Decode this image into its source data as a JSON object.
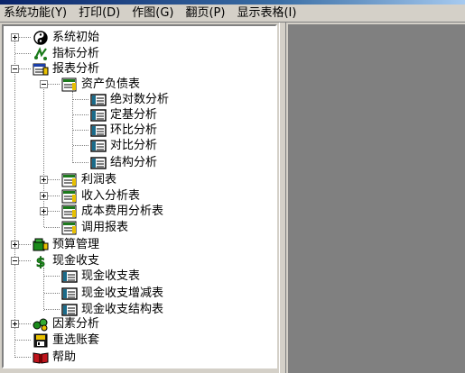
{
  "menubar": {
    "items": [
      "系统功能(Y)",
      "打印(D)",
      "作图(G)",
      "翻页(P)",
      "显示表格(I)"
    ]
  },
  "tree": {
    "system_init": "系统初始",
    "indicator_analysis": "指标分析",
    "report_analysis": "报表分析",
    "balance_sheet": "资产负债表",
    "absolute_analysis": "绝对数分析",
    "base_analysis": "定基分析",
    "sequential_analysis": "环比分析",
    "comparison_analysis": "对比分析",
    "structure_analysis": "结构分析",
    "income_statement": "利润表",
    "revenue_analysis": "收入分析表",
    "cost_analysis": "成本费用分析表",
    "call_report": "调用报表",
    "budget_management": "预算管理",
    "cash_flow": "现金收支",
    "cash_flow_table": "现金收支表",
    "cash_flow_change": "现金收支增减表",
    "cash_flow_structure": "现金收支结构表",
    "factor_analysis": "因素分析",
    "reselect_ledger": "重选账套",
    "help": "帮助"
  }
}
